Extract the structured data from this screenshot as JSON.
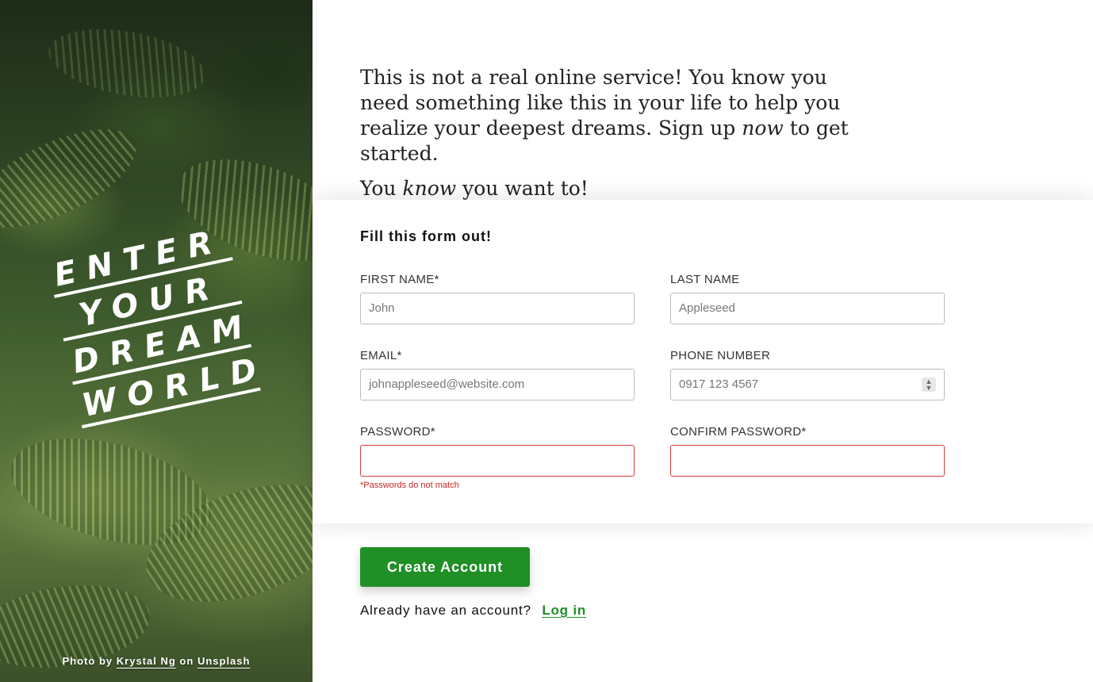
{
  "hero": {
    "logo_lines": [
      "ENTER",
      "YOUR",
      "DREAM",
      "WORLD"
    ],
    "credit_prefix": "Photo by",
    "credit_author": "Krystal Ng",
    "credit_middle": "on",
    "credit_source": "Unsplash"
  },
  "intro": {
    "para1_a": "This is not a real online service! You know you need something like this in your life to help you realize your deepest dreams. Sign up",
    "para1_em": "now",
    "para1_b": "to get started.",
    "para2_a": "You",
    "para2_em": "know",
    "para2_b": "you want to!"
  },
  "form": {
    "title": "Fill this form out!",
    "first_name": {
      "label": "FIRST NAME*",
      "placeholder": "John"
    },
    "last_name": {
      "label": "LAST NAME",
      "placeholder": "Appleseed"
    },
    "email": {
      "label": "EMAIL*",
      "placeholder": "johnappleseed@website.com"
    },
    "phone": {
      "label": "PHONE NUMBER",
      "placeholder": "0917 123 4567"
    },
    "password": {
      "label": "PASSWORD*",
      "value": "",
      "error": "*Passwords do not match"
    },
    "confirm_password": {
      "label": "CONFIRM PASSWORD*",
      "value": ""
    }
  },
  "actions": {
    "create_label": "Create Account",
    "login_prompt": "Already have an account?",
    "login_link": "Log in"
  },
  "colors": {
    "accent": "#1f8f26",
    "error": "#c62828"
  }
}
